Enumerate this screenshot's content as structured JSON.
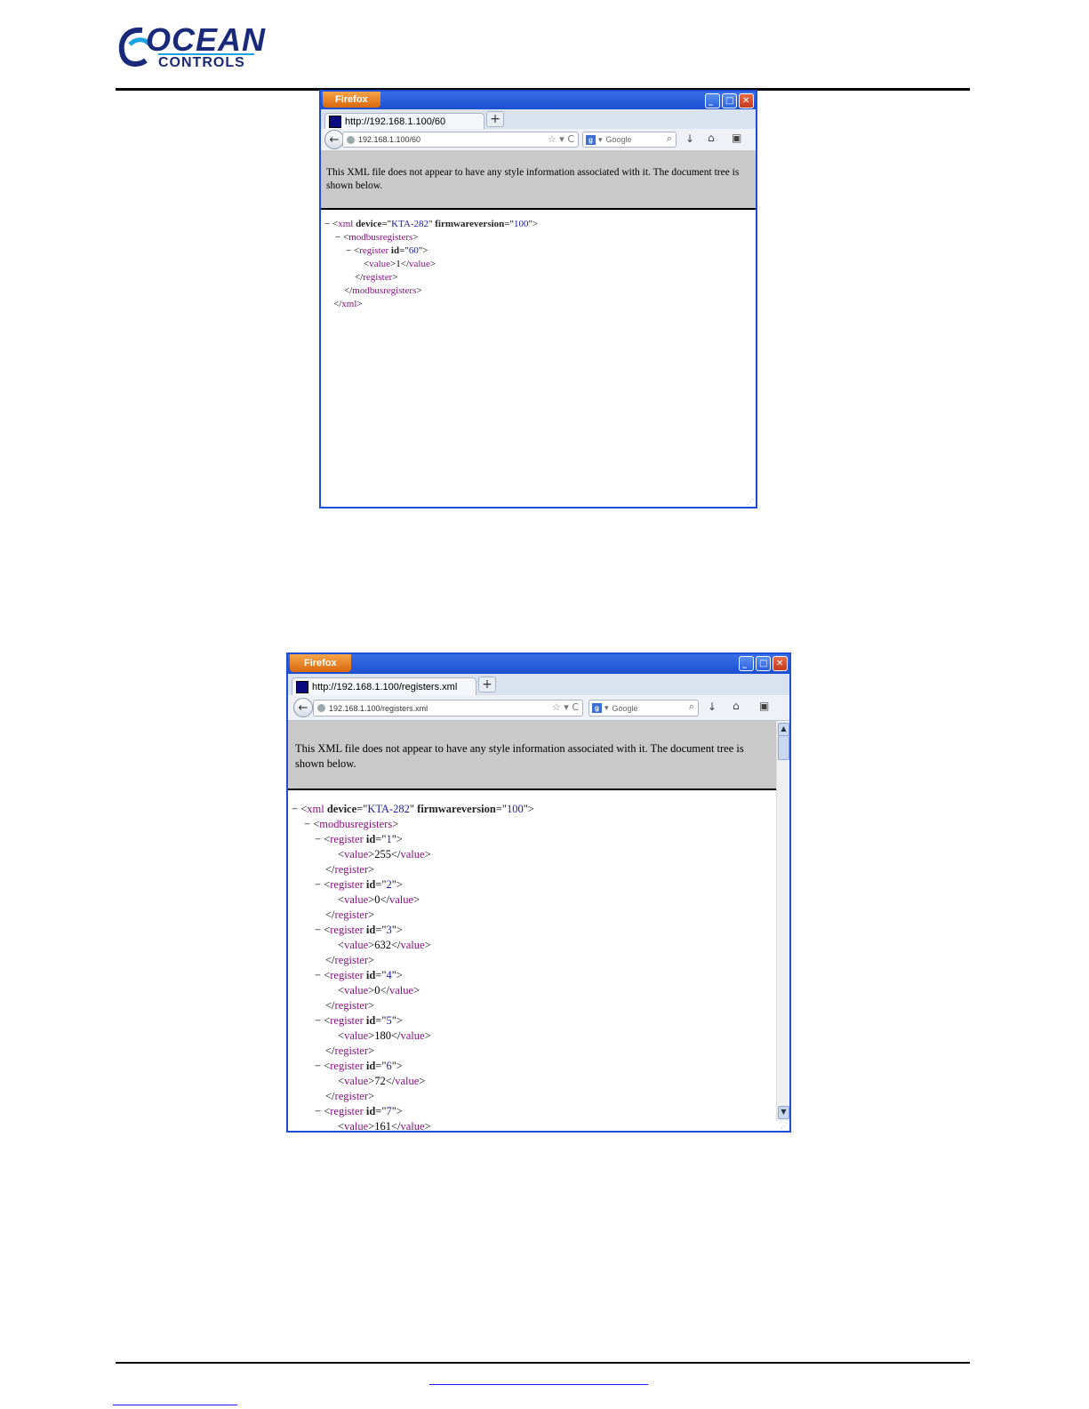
{
  "logo": {
    "line1": "OCEAN",
    "line2": "CONTROLS"
  },
  "win1": {
    "firefox_label": "Firefox",
    "tab_title": "http://192.168.1.100/60",
    "url": "192.168.1.100/60",
    "search_placeholder": "Google",
    "info": "This XML file does not appear to have any style information associated with it. The document tree is shown below.",
    "xml": {
      "device": "KTA-282",
      "firmwareversion": "100",
      "register_id": "60",
      "value": "1"
    }
  },
  "win2": {
    "firefox_label": "Firefox",
    "tab_title": "http://192.168.1.100/registers.xml",
    "url": "192.168.1.100/registers.xml",
    "search_placeholder": "Google",
    "info": "This XML file does not appear to have any style information associated with it. The document tree is shown below.",
    "xml": {
      "device": "KTA-282",
      "firmwareversion": "100",
      "registers": [
        {
          "id": "1",
          "value": "255"
        },
        {
          "id": "2",
          "value": "0"
        },
        {
          "id": "3",
          "value": "632"
        },
        {
          "id": "4",
          "value": "0"
        },
        {
          "id": "5",
          "value": "180"
        },
        {
          "id": "6",
          "value": "72"
        },
        {
          "id": "7",
          "value": "161"
        }
      ]
    }
  },
  "icons": {
    "back": "←",
    "star": "☆",
    "dropdown": "▾",
    "reload": "C",
    "search": "⌕",
    "download": "↓",
    "home": "⌂",
    "bookmarks": "▣",
    "minimize": "_",
    "maximize": "□",
    "close": "✕",
    "collapse": "−",
    "newtab": "+"
  }
}
